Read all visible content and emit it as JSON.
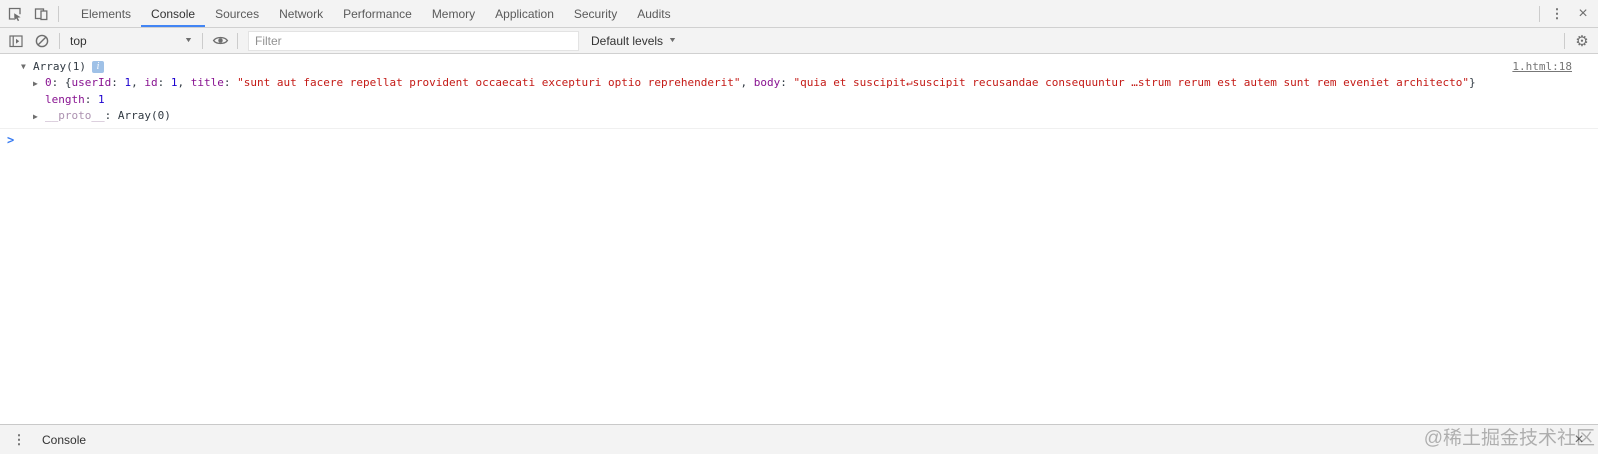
{
  "main_tabs": [
    "Elements",
    "Console",
    "Sources",
    "Network",
    "Performance",
    "Memory",
    "Application",
    "Security",
    "Audits"
  ],
  "active_tab": "Console",
  "toolbar": {
    "context_selector_value": "top",
    "filter_placeholder": "Filter",
    "levels_label": "Default levels"
  },
  "console": {
    "array_label": "Array(1)",
    "source_link": "1.html:18",
    "preview": {
      "index": "0",
      "open": ": {",
      "key_userid": "userId",
      "val_userid": "1",
      "key_id": "id",
      "val_id": "1",
      "key_title": "title",
      "val_title": "\"sunt aut facere repellat provident occaecati excepturi optio reprehenderit\"",
      "key_body": "body",
      "val_body": "\"quia et suscipit↵suscipit recusandae consequuntur …strum rerum est autem sunt rem eveniet architecto\"",
      "sep": ", ",
      "colon": ": ",
      "close": "}"
    },
    "length_key": "length",
    "length_colon": ": ",
    "length_value": "1",
    "proto_key": "__proto__",
    "proto_colon": ": ",
    "proto_value": "Array(0)"
  },
  "drawer": {
    "tab_label": "Console"
  },
  "watermark": "@稀土掘金技术社区",
  "icons": {
    "expanded": "▼",
    "collapsed": "▶",
    "info": "i",
    "dropdown_arrow": "▼",
    "kebab": "⋮",
    "close": "×",
    "gear": "⚙",
    "prompt": ">"
  },
  "colors": {
    "accent_blue": "#4285f4",
    "key_purple": "#881391",
    "number_blue": "#1c00cf",
    "string_red": "#c41a16",
    "toolbar_bg": "#f3f3f3"
  }
}
